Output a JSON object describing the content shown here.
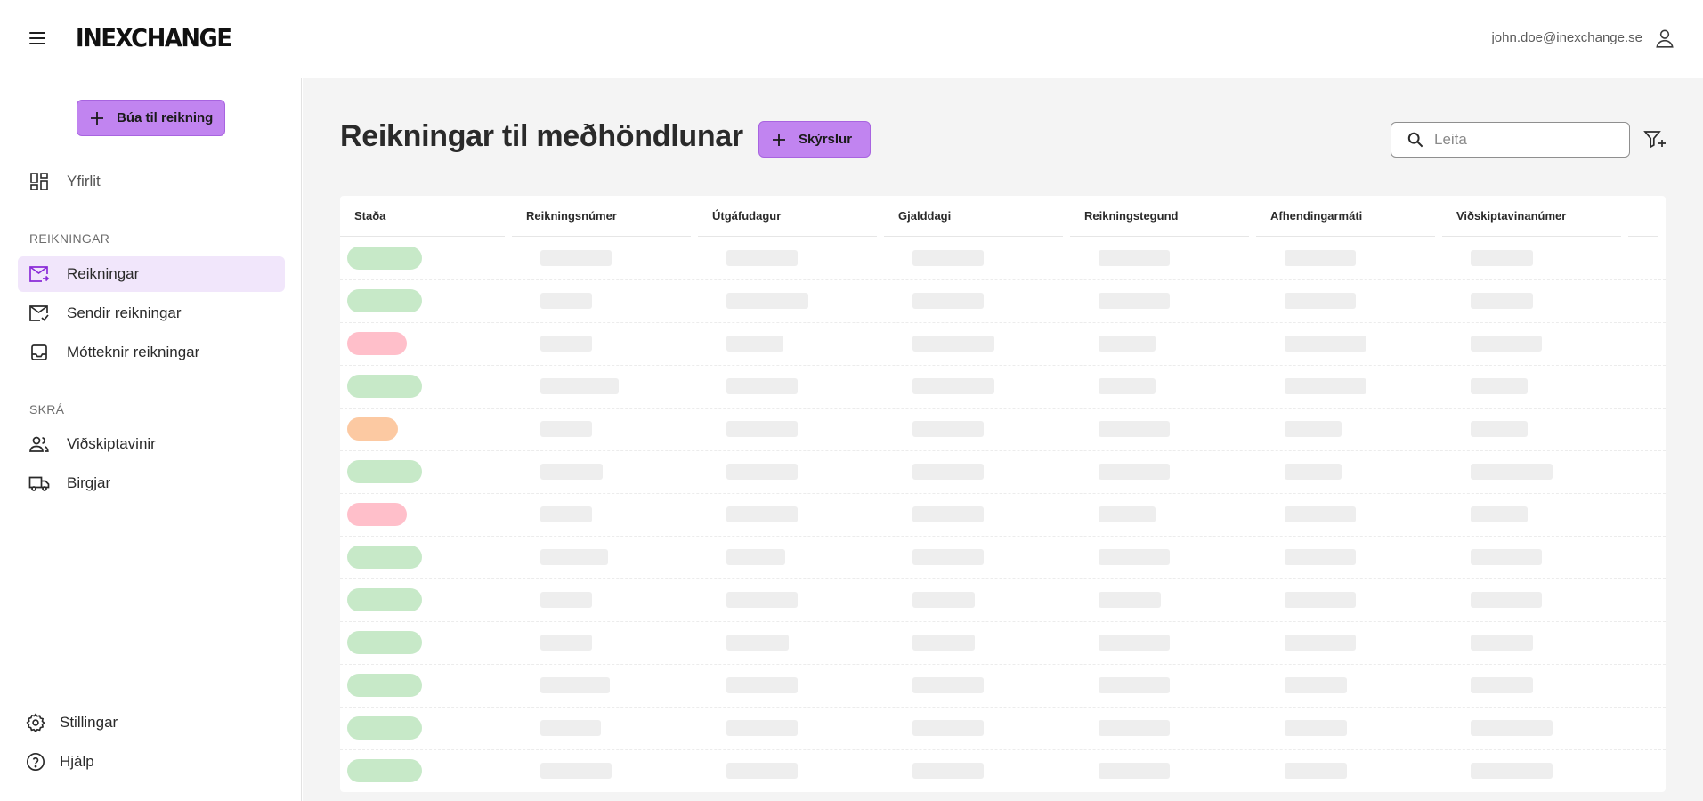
{
  "header": {
    "logo": "INEXCHANGE",
    "user_email": "john.doe@inexchange.se"
  },
  "sidebar": {
    "create_button_label": "Búa til reikning",
    "overview_label": "Yfirlit",
    "sections": [
      {
        "label": "REIKNINGAR"
      },
      {
        "label": "SKRÁ"
      }
    ],
    "invoice_items": [
      {
        "label": "Reikningar",
        "active": true,
        "icon": "mail-arrow-icon"
      },
      {
        "label": "Sendir reikningar",
        "active": false,
        "icon": "mail-check-icon"
      },
      {
        "label": "Mótteknir reikningar",
        "active": false,
        "icon": "inbox-icon"
      }
    ],
    "registry_items": [
      {
        "label": "Viðskiptavinir",
        "icon": "users-icon"
      },
      {
        "label": "Birgjar",
        "icon": "truck-icon"
      }
    ],
    "footer_items": [
      {
        "label": "Stillingar",
        "icon": "gear-icon"
      },
      {
        "label": "Hjálp",
        "icon": "help-icon"
      }
    ]
  },
  "main": {
    "title": "Reikningar til meðhöndlunar",
    "reports_button_label": "Skýrslur",
    "search_placeholder": "Leita",
    "columns": [
      "Staða",
      "Reikningsnúmer",
      "Útgáfudagur",
      "Gjalddagi",
      "Reikningstegund",
      "Afhendingarmáti",
      "Viðskiptavinanúmer"
    ],
    "row_statuses": [
      "ok",
      "ok",
      "error",
      "ok",
      "warning",
      "ok",
      "error",
      "ok",
      "ok",
      "ok",
      "ok",
      "ok",
      "ok"
    ]
  },
  "colors": {
    "accent": "#c184f0",
    "active_nav_bg": "#f1e6fb",
    "status_ok": "#c7e9c8",
    "status_error": "#ffbfca",
    "status_warning": "#fcc9a2"
  }
}
